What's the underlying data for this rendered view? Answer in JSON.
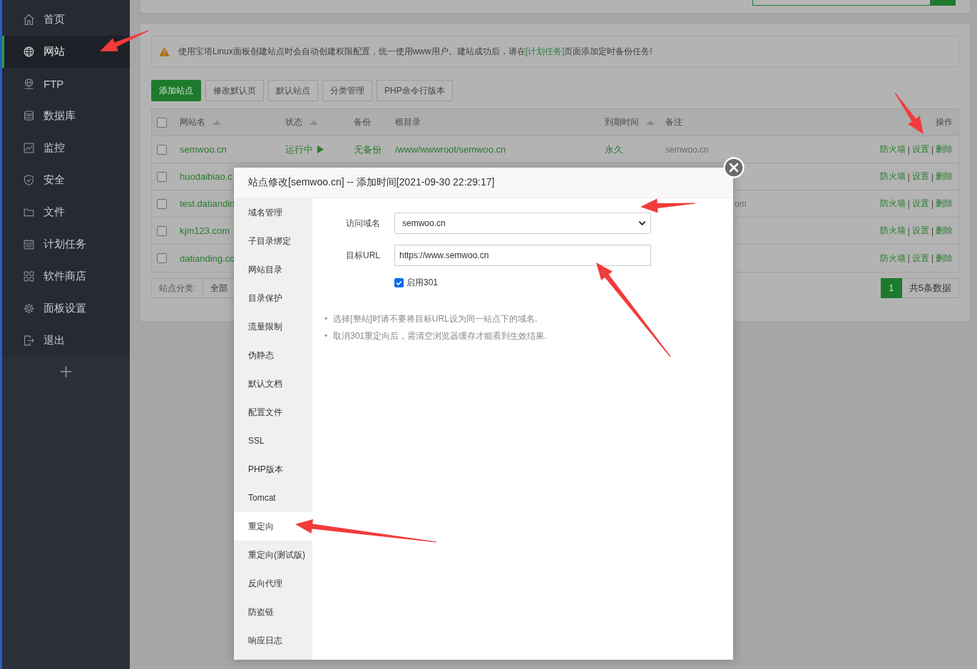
{
  "sidebar": {
    "items": [
      {
        "label": "首页",
        "selected": false
      },
      {
        "label": "网站",
        "selected": true
      },
      {
        "label": "FTP",
        "selected": false
      },
      {
        "label": "数据库",
        "selected": false
      },
      {
        "label": "监控",
        "selected": false
      },
      {
        "label": "安全",
        "selected": false
      },
      {
        "label": "文件",
        "selected": false
      },
      {
        "label": "计划任务",
        "selected": false
      },
      {
        "label": "软件商店",
        "selected": false
      },
      {
        "label": "面板设置",
        "selected": false
      },
      {
        "label": "退出",
        "selected": false
      }
    ],
    "add_label": "+"
  },
  "notice": {
    "before": "使用宝塔Linux面板创建站点时会自动创建权限配置，统一使用www用户。建站成功后，请在",
    "link": "[计划任务]",
    "after": "页面添加定时备份任务!"
  },
  "toolbar": {
    "buttons": [
      {
        "label": "添加站点",
        "primary": true
      },
      {
        "label": "修改默认页",
        "primary": false
      },
      {
        "label": "默认站点",
        "primary": false
      },
      {
        "label": "分类管理",
        "primary": false
      },
      {
        "label": "PHP命令行版本",
        "primary": false
      }
    ]
  },
  "table": {
    "select_all_checked": false,
    "action_separator": "|",
    "columns": [
      {
        "label": "网站名",
        "sortable": true
      },
      {
        "label": "状态",
        "sortable": true
      },
      {
        "label": "备份",
        "sortable": false
      },
      {
        "label": "根目录",
        "sortable": false
      },
      {
        "label": "到期时间",
        "sortable": true
      },
      {
        "label": "备注",
        "sortable": false
      },
      {
        "label": "操作",
        "sortable": false
      }
    ],
    "rows": [
      {
        "checked": false,
        "name": "semwoo.cn",
        "status": "运行中",
        "backup": "无备份",
        "root": "/www/wwwroot/semwoo.cn",
        "expiry": "永久",
        "remark": "semwoo.cn",
        "actions": [
          "防火墙",
          "设置",
          "删除"
        ]
      },
      {
        "checked": false,
        "name": "huodaibiao.c",
        "actions": [
          "防火墙",
          "设置",
          "删除"
        ]
      },
      {
        "checked": false,
        "name": "test.datiandin",
        "remark_tail": "om",
        "actions": [
          "防火墙",
          "设置",
          "删除"
        ]
      },
      {
        "checked": false,
        "name": "kjm123.com",
        "actions": [
          "防火墙",
          "设置",
          "删除"
        ]
      },
      {
        "checked": false,
        "name": "datianding.co",
        "actions": [
          "防火墙",
          "设置",
          "删除"
        ]
      }
    ]
  },
  "footer": {
    "category_label": "站点分类:",
    "category_value": "全部",
    "pages": [
      {
        "label": "1",
        "selected": true
      }
    ],
    "total": "共5条数据"
  },
  "dialog": {
    "title": "站点修改[semwoo.cn] -- 添加时间[2021-09-30 22:29:17]",
    "nav": [
      {
        "label": "域名管理",
        "selected": false
      },
      {
        "label": "子目录绑定",
        "selected": false
      },
      {
        "label": "网站目录",
        "selected": false
      },
      {
        "label": "目录保护",
        "selected": false
      },
      {
        "label": "流量限制",
        "selected": false
      },
      {
        "label": "伪静态",
        "selected": false
      },
      {
        "label": "默认文档",
        "selected": false
      },
      {
        "label": "配置文件",
        "selected": false
      },
      {
        "label": "SSL",
        "selected": false
      },
      {
        "label": "PHP版本",
        "selected": false
      },
      {
        "label": "Tomcat",
        "selected": false
      },
      {
        "label": "重定向",
        "selected": true
      },
      {
        "label": "重定向(测试版)",
        "selected": false
      },
      {
        "label": "反向代理",
        "selected": false
      },
      {
        "label": "防盗链",
        "selected": false
      },
      {
        "label": "响应日志",
        "selected": false
      }
    ],
    "form": {
      "domain_label": "访问域名",
      "domain_value": "semwoo.cn",
      "url_label": "目标URL",
      "url_value": "https://www.semwoo.cn",
      "enable_label": "启用301",
      "enable_checked": true
    },
    "notes": [
      {
        "bullet": "•",
        "text": "选择[整站]时请不要将目标URL设为同一站点下的域名."
      },
      {
        "bullet": "•",
        "text": "取消301重定向后，需清空浏览器缓存才能看到生效结果."
      }
    ]
  }
}
